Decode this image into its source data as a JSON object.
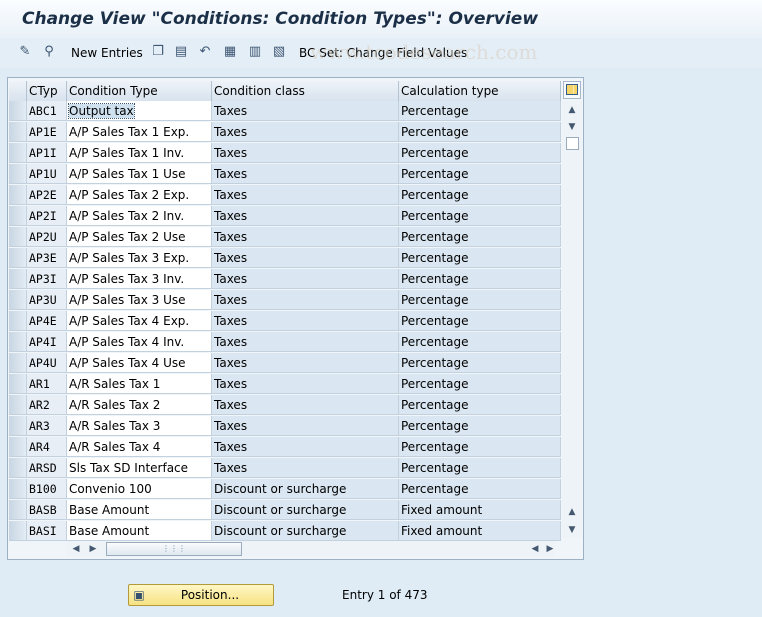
{
  "window": {
    "title": "Change View \"Conditions: Condition Types\": Overview"
  },
  "toolbar": {
    "icons": [
      "edit-icon",
      "display-change-icon",
      "copy-icon",
      "delete-icon",
      "undo-icon",
      "select-all-icon",
      "select-block-icon",
      "deselect-all-icon"
    ],
    "new_entries_label": "New Entries",
    "bc_set_label": "BC Set: Change Field Values",
    "watermark": "www.tcodesearch.com"
  },
  "table": {
    "headers": {
      "ctyp": "CTyp",
      "name": "Condition Type",
      "class": "Condition class",
      "calc": "Calculation type"
    },
    "rows": [
      {
        "ctyp": "ABC1",
        "name": "Output tax",
        "class": "Taxes",
        "calc": "Percentage"
      },
      {
        "ctyp": "AP1E",
        "name": "A/P Sales Tax 1 Exp.",
        "class": "Taxes",
        "calc": "Percentage"
      },
      {
        "ctyp": "AP1I",
        "name": "A/P Sales Tax 1 Inv.",
        "class": "Taxes",
        "calc": "Percentage"
      },
      {
        "ctyp": "AP1U",
        "name": "A/P Sales Tax 1 Use",
        "class": "Taxes",
        "calc": "Percentage"
      },
      {
        "ctyp": "AP2E",
        "name": "A/P Sales Tax 2 Exp.",
        "class": "Taxes",
        "calc": "Percentage"
      },
      {
        "ctyp": "AP2I",
        "name": "A/P Sales Tax 2 Inv.",
        "class": "Taxes",
        "calc": "Percentage"
      },
      {
        "ctyp": "AP2U",
        "name": "A/P Sales Tax 2 Use",
        "class": "Taxes",
        "calc": "Percentage"
      },
      {
        "ctyp": "AP3E",
        "name": "A/P Sales Tax 3 Exp.",
        "class": "Taxes",
        "calc": "Percentage"
      },
      {
        "ctyp": "AP3I",
        "name": "A/P Sales Tax 3 Inv.",
        "class": "Taxes",
        "calc": "Percentage"
      },
      {
        "ctyp": "AP3U",
        "name": "A/P Sales Tax 3 Use",
        "class": "Taxes",
        "calc": "Percentage"
      },
      {
        "ctyp": "AP4E",
        "name": "A/P Sales Tax 4 Exp.",
        "class": "Taxes",
        "calc": "Percentage"
      },
      {
        "ctyp": "AP4I",
        "name": "A/P Sales Tax 4 Inv.",
        "class": "Taxes",
        "calc": "Percentage"
      },
      {
        "ctyp": "AP4U",
        "name": "A/P Sales Tax 4 Use",
        "class": "Taxes",
        "calc": "Percentage"
      },
      {
        "ctyp": "AR1",
        "name": "A/R Sales Tax 1",
        "class": "Taxes",
        "calc": "Percentage"
      },
      {
        "ctyp": "AR2",
        "name": "A/R Sales Tax 2",
        "class": "Taxes",
        "calc": "Percentage"
      },
      {
        "ctyp": "AR3",
        "name": "A/R Sales Tax 3",
        "class": "Taxes",
        "calc": "Percentage"
      },
      {
        "ctyp": "AR4",
        "name": "A/R Sales Tax 4",
        "class": "Taxes",
        "calc": "Percentage"
      },
      {
        "ctyp": "ARSD",
        "name": "Sls Tax SD Interface",
        "class": "Taxes",
        "calc": "Percentage"
      },
      {
        "ctyp": "B100",
        "name": "Convenio 100",
        "class": "Discount or surcharge",
        "calc": "Percentage"
      },
      {
        "ctyp": "BASB",
        "name": "Base Amount",
        "class": "Discount or surcharge",
        "calc": "Fixed amount"
      },
      {
        "ctyp": "BASI",
        "name": "Base Amount",
        "class": "Discount or surcharge",
        "calc": "Fixed amount"
      }
    ]
  },
  "footer": {
    "position_label": "Position...",
    "entry_text": "Entry 1 of 473"
  },
  "colors": {
    "background": "#dfebf5",
    "title": "#1b2f47",
    "button": "#f6e282"
  }
}
